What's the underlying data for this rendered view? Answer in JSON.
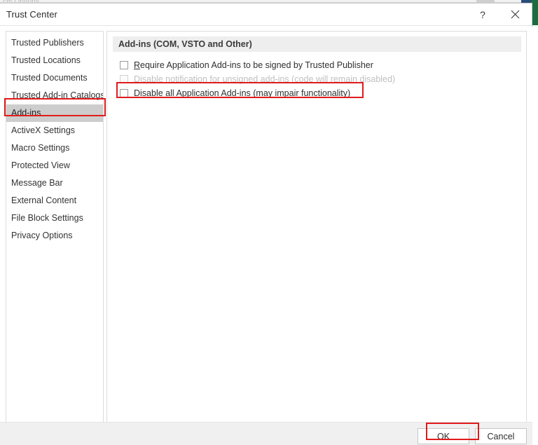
{
  "underlying": {
    "partial_title": "cel Options"
  },
  "dialog": {
    "title": "Trust Center",
    "help_icon": "question-mark-icon",
    "close_icon": "close-x-icon"
  },
  "sidebar": {
    "items": [
      {
        "label": "Trusted Publishers",
        "selected": false
      },
      {
        "label": "Trusted Locations",
        "selected": false
      },
      {
        "label": "Trusted Documents",
        "selected": false
      },
      {
        "label": "Trusted Add-in Catalogs",
        "selected": false
      },
      {
        "label": "Add-ins",
        "selected": true
      },
      {
        "label": "ActiveX Settings",
        "selected": false
      },
      {
        "label": "Macro Settings",
        "selected": false
      },
      {
        "label": "Protected View",
        "selected": false
      },
      {
        "label": "Message Bar",
        "selected": false
      },
      {
        "label": "External Content",
        "selected": false
      },
      {
        "label": "File Block Settings",
        "selected": false
      },
      {
        "label": "Privacy Options",
        "selected": false
      }
    ]
  },
  "content": {
    "section_title": "Add-ins (COM, VSTO and Other)",
    "options": [
      {
        "prefix": "",
        "accesskey": "R",
        "suffix": "equire Application Add-ins to be signed by Trusted Publisher",
        "checked": false,
        "disabled": false
      },
      {
        "prefix": "Disable ",
        "accesskey": "n",
        "suffix": "otification for unsigned add-ins (code will remain disabled)",
        "checked": false,
        "disabled": true
      },
      {
        "prefix": "",
        "accesskey": "D",
        "suffix": "isable all Application Add-ins (may impair functionality)",
        "checked": false,
        "disabled": false
      }
    ]
  },
  "footer": {
    "ok_label": "OK",
    "cancel_label": "Cancel"
  },
  "annotations": {
    "color": "#e01b1b",
    "targets": [
      "sidebar-item-add-ins",
      "disable-all-addins-checkbox",
      "ok-button"
    ]
  }
}
